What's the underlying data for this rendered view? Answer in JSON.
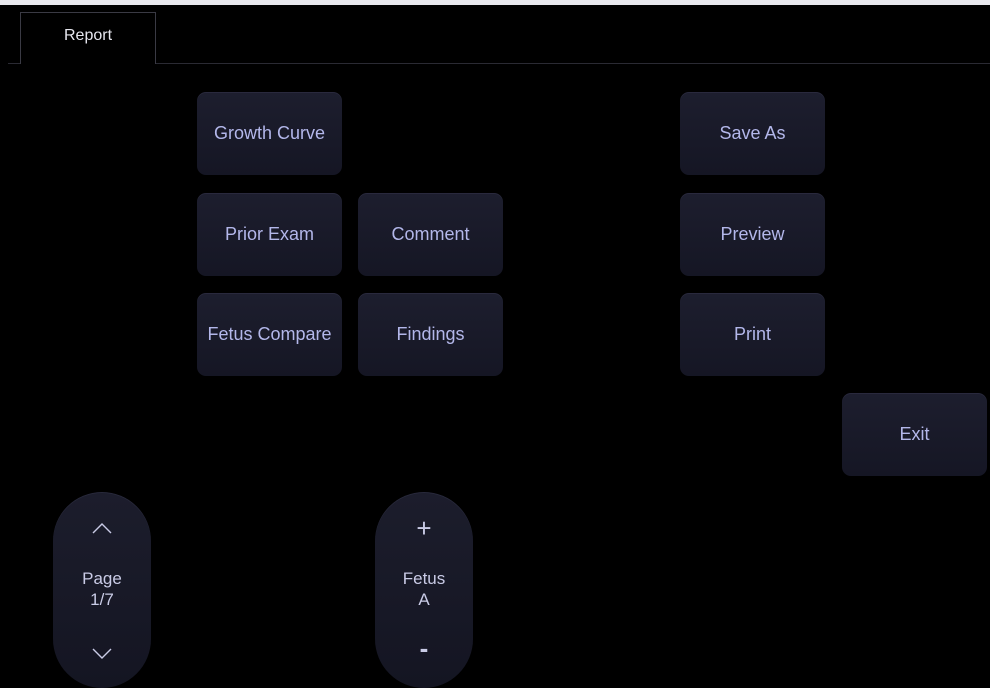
{
  "tabs": [
    {
      "label": "Report"
    }
  ],
  "buttons": {
    "growth_curve": "Growth Curve",
    "prior_exam": "Prior Exam",
    "comment": "Comment",
    "fetus_compare": "Fetus Compare",
    "findings": "Findings",
    "save_as": "Save As",
    "preview": "Preview",
    "print": "Print",
    "exit": "Exit"
  },
  "page_control": {
    "label": "Page",
    "value": "1/7",
    "up_icon": "chevron-up-icon",
    "down_icon": "chevron-down-icon"
  },
  "fetus_control": {
    "label": "Fetus",
    "value": "A",
    "increment_symbol": "+",
    "decrement_symbol": "-"
  },
  "colors": {
    "background": "#000000",
    "button_fill": "#1a1b2a",
    "button_text": "#b3b7ea"
  }
}
